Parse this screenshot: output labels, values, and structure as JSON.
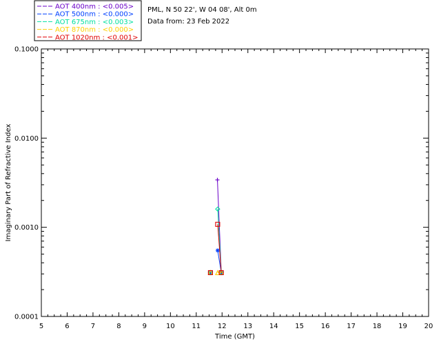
{
  "header": {
    "location": "PML, N 50 22', W 04 08', Alt 0m",
    "date": "Data from: 23 Feb 2022"
  },
  "colors": {
    "aot_400": "#6a00c8",
    "aot_500": "#0040ff",
    "aot_675": "#00e0a0",
    "aot_870": "#ffd000",
    "aot_1020": "#e00000",
    "axis": "#000000",
    "background": "#ffffff"
  },
  "chart_data": {
    "type": "line",
    "title": "",
    "xlabel": "Time (GMT)",
    "ylabel": "Imaginary Part of Refractive Index",
    "xlim": [
      5,
      20
    ],
    "ylim": [
      0.0001,
      0.1
    ],
    "yscale": "log",
    "x_ticks": [
      "5",
      "6",
      "7",
      "8",
      "9",
      "10",
      "11",
      "12",
      "13",
      "14",
      "15",
      "16",
      "17",
      "18",
      "19",
      "20"
    ],
    "y_ticks": [
      "0.0001",
      "0.0010",
      "0.0100",
      "0.1000"
    ],
    "grid": false,
    "legend_position": "top-left, above plot",
    "series": [
      {
        "name": "AOT  400nm : <0.005>",
        "color": "#6a00c8",
        "marker": "plus",
        "x": [
          11.55,
          11.82,
          11.97
        ],
        "y": [
          0.00031,
          0.0034,
          0.00031
        ]
      },
      {
        "name": "AOT  500nm : <0.000>",
        "color": "#0040ff",
        "marker": "asterisk",
        "x": [
          11.55,
          11.83,
          11.97
        ],
        "y": [
          0.00031,
          0.00055,
          0.00031
        ]
      },
      {
        "name": "AOT  675nm : <0.003>",
        "color": "#00e0a0",
        "marker": "diamond",
        "x": [
          11.55,
          11.83,
          11.97
        ],
        "y": [
          0.00031,
          0.0016,
          0.00031
        ]
      },
      {
        "name": "AOT  870nm : <0.000>",
        "color": "#ffd000",
        "marker": "triangle",
        "x": [
          11.55,
          11.83,
          11.97
        ],
        "y": [
          0.00031,
          0.00031,
          0.00031
        ]
      },
      {
        "name": "AOT 1020nm : <0.001>",
        "color": "#e00000",
        "marker": "square",
        "x": [
          11.55,
          11.83,
          11.97
        ],
        "y": [
          0.00031,
          0.00108,
          0.00031
        ]
      }
    ]
  }
}
